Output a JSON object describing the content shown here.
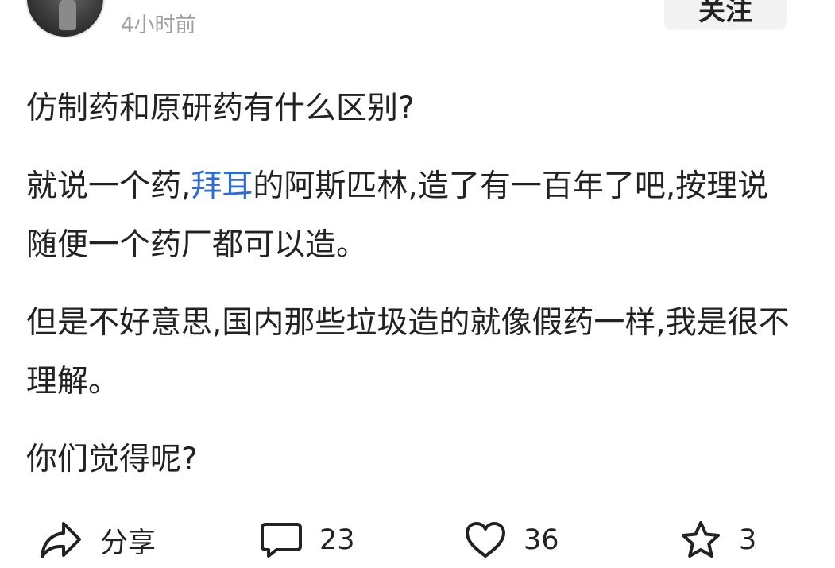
{
  "author": {
    "timestamp": "4小时前"
  },
  "follow_button": {
    "label": "关注"
  },
  "post": {
    "question": "仿制药和原研药有什么区别?",
    "p2_before": "就说一个药,",
    "p2_link": "拜耳",
    "p2_after": "的阿斯匹林,造了有一百年了吧,按理说随便一个药厂都可以造。",
    "p3": "但是不好意思,国内那些垃圾造的就像假药一样,我是很不理解。",
    "p4": "你们觉得呢?"
  },
  "actions": {
    "share": {
      "label": "分享",
      "icon": "share-icon"
    },
    "comment": {
      "count": "23",
      "icon": "comment-icon"
    },
    "like": {
      "count": "36",
      "icon": "heart-icon"
    },
    "favorite": {
      "count": "3",
      "icon": "star-icon"
    }
  },
  "colors": {
    "link": "#2f6bd8",
    "text": "#222222",
    "muted": "#a0a0a0",
    "follow_bg": "#f2f2f2"
  }
}
